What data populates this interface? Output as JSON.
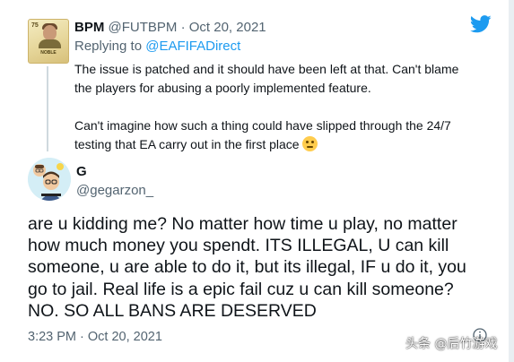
{
  "quoted_tweet": {
    "display_name": "BPM",
    "handle": "@FUTBPM",
    "separator": "·",
    "date": "Oct 20, 2021",
    "replying_to_prefix": "Replying to",
    "replying_to_handle": "@EAFIFADirect",
    "paragraph_1_line_1": "The issue is patched and it should have been left at that. Can't blame",
    "paragraph_1_line_2": "the players for abusing a poorly implemented feature.",
    "paragraph_2_line_1": "Can't imagine how such a thing could have slipped through the 24/7",
    "paragraph_2_line_2": "testing that EA carry out in the first place",
    "emoji_icon": "slightly-frowning-emoji",
    "avatar_card_name": "NOBLE",
    "avatar_card_rating": "75"
  },
  "main_tweet": {
    "display_name": "G",
    "handle": "@gegarzon_",
    "text_lines": [
      "are u kidding me? No matter how time u play, no matter",
      "how much money you spendt. ITS ILLEGAL, U can kill",
      "someone, u are able to do it, but its illegal, IF u do it, you",
      "go to jail. Real life is a epic fail cuz u can kill someone?",
      "NO. SO ALL BANS ARE DESERVED"
    ],
    "time": "3:23 PM",
    "separator": "·",
    "date": "Oct 20, 2021"
  },
  "watermark": "头条 @后竹游戏",
  "colors": {
    "brand_blue": "#1d9bf0",
    "secondary_text": "#536471",
    "primary_text": "#0f1419"
  }
}
